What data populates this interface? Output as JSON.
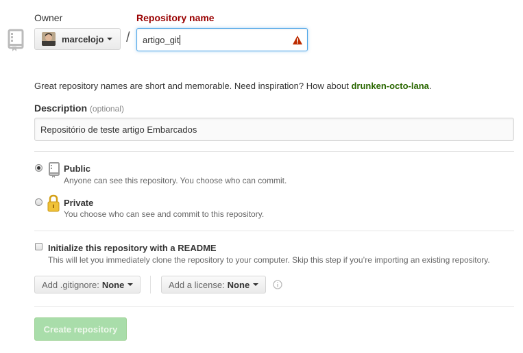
{
  "owner": {
    "label": "Owner",
    "value": "marcelojo"
  },
  "repository_name": {
    "label": "Repository name",
    "value": "artigo_git"
  },
  "hint": {
    "text": "Great repository names are short and memorable. Need inspiration? How about",
    "suggestion": "drunken-octo-lana",
    "suffix": "."
  },
  "description": {
    "label": "Description",
    "optional": "(optional)",
    "value": "Repositório de teste artigo Embarcados"
  },
  "visibility": {
    "public": {
      "title": "Public",
      "desc": "Anyone can see this repository. You choose who can commit.",
      "checked": true
    },
    "private": {
      "title": "Private",
      "desc": "You choose who can see and commit to this repository.",
      "checked": false
    }
  },
  "readme": {
    "title": "Initialize this repository with a README",
    "desc": "This will let you immediately clone the repository to your computer. Skip this step if you’re importing an existing repository.",
    "checked": false
  },
  "gitignore": {
    "label": "Add .gitignore:",
    "value": "None"
  },
  "license": {
    "label": "Add a license:",
    "value": "None"
  },
  "create_button": "Create repository",
  "colors": {
    "accent_blue": "#51a7e8",
    "error_red": "#990000",
    "suggestion_green": "#2a6700",
    "button_disabled_green": "#a9ddaa"
  },
  "icons": [
    "repo-icon",
    "warning-icon",
    "public-repo-icon",
    "lock-icon",
    "info-icon",
    "caret-down-icon"
  ]
}
